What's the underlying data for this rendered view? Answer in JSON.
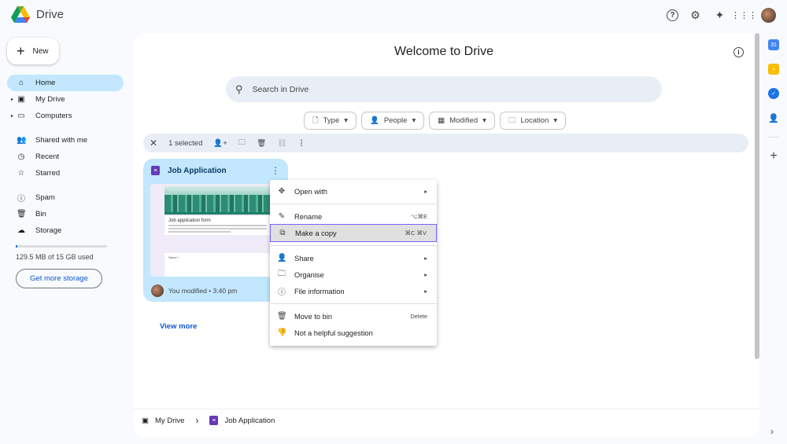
{
  "app": {
    "name": "Drive"
  },
  "header": {
    "icons": [
      "help-icon",
      "settings-icon",
      "gemini-icon",
      "apps-icon",
      "avatar"
    ]
  },
  "sidebar": {
    "new_label": "New",
    "items": [
      {
        "label": "Home",
        "icon": "home"
      },
      {
        "label": "My Drive",
        "icon": "drive"
      },
      {
        "label": "Computers",
        "icon": "computer"
      },
      {
        "label": "Shared with me",
        "icon": "people"
      },
      {
        "label": "Recent",
        "icon": "clock"
      },
      {
        "label": "Starred",
        "icon": "star"
      },
      {
        "label": "Spam",
        "icon": "spam"
      },
      {
        "label": "Bin",
        "icon": "bin"
      },
      {
        "label": "Storage",
        "icon": "cloud"
      }
    ],
    "storage_text": "129.5 MB of 15 GB used",
    "storage_fraction": 0.0084,
    "get_more": "Get more storage"
  },
  "main": {
    "title": "Welcome to Drive",
    "search_placeholder": "Search in Drive",
    "filters": [
      "Type",
      "People",
      "Modified",
      "Location"
    ],
    "selection": "1 selected",
    "file": {
      "name": "Job Application",
      "preview_title": "Job application form",
      "preview_field": "Name *",
      "modified": "You modified • 3:40 pm"
    },
    "view_more": "View more"
  },
  "menu": {
    "items": [
      {
        "label": "Open with"
      },
      {
        "label": "Rename",
        "shortcut": "⌥⌘E"
      },
      {
        "label": "Make a copy",
        "shortcut": "⌘C ⌘V"
      },
      {
        "label": "Share"
      },
      {
        "label": "Organise"
      },
      {
        "label": "File information"
      },
      {
        "label": "Move to bin",
        "shortcut": "Delete"
      },
      {
        "label": "Not a helpful suggestion"
      }
    ]
  },
  "breadcrumb": {
    "root": "My Drive",
    "file": "Job Application"
  },
  "colors": {
    "accent": "#c2e7ff",
    "link": "#0b57d0",
    "highlight": "#7b61ff"
  }
}
